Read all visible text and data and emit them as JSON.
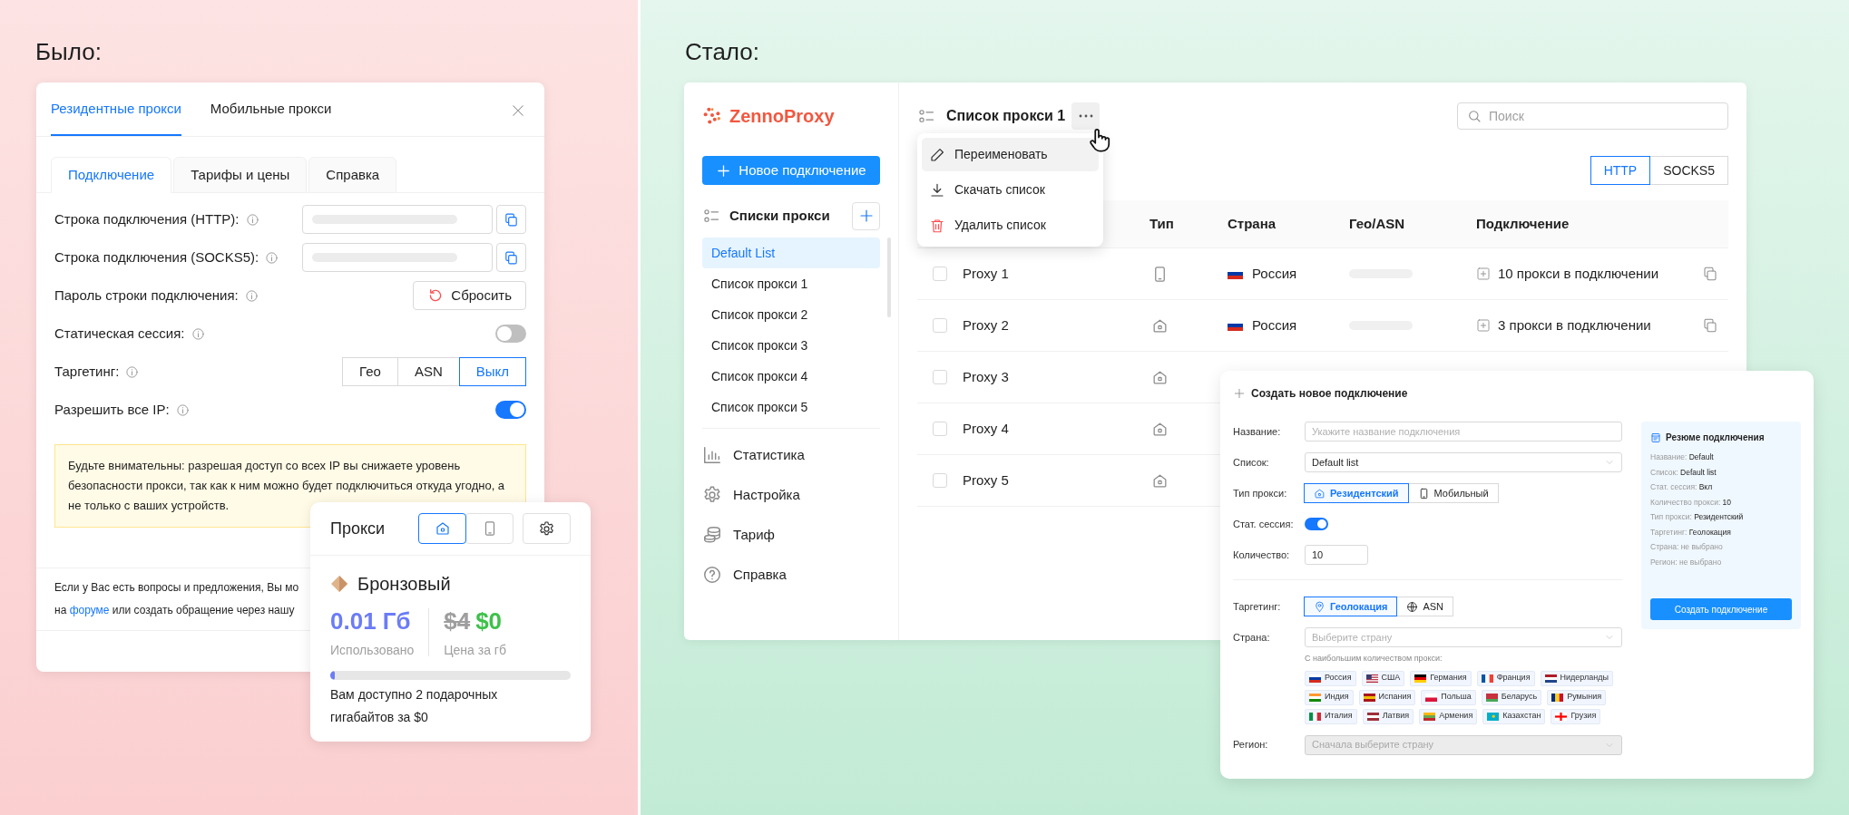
{
  "before": {
    "heading": "Было:",
    "dialog": {
      "tabs": [
        {
          "label": "Резидентные прокси",
          "selected": true
        },
        {
          "label": "Мобильные прокси",
          "selected": false
        }
      ],
      "subtabs": [
        {
          "label": "Подключение",
          "selected": true
        },
        {
          "label": "Тарифы и цены",
          "selected": false
        },
        {
          "label": "Справка",
          "selected": false
        }
      ],
      "rows": [
        {
          "kind": "copy_field",
          "label": "Строка подключения (HTTP):"
        },
        {
          "kind": "copy_field",
          "label": "Строка подключения (SOCKS5):"
        },
        {
          "kind": "button",
          "label": "Пароль строки подключения:",
          "button": "Сбросить"
        },
        {
          "kind": "toggle",
          "label": "Статическая сессия:",
          "on": false
        },
        {
          "kind": "segmented",
          "label": "Таргетинг:",
          "options": [
            {
              "label": "Гео",
              "selected": false
            },
            {
              "label": "ASN",
              "selected": false
            },
            {
              "label": "Выкл",
              "selected": true
            }
          ]
        },
        {
          "kind": "toggle",
          "label": "Разрешить все IP:",
          "on": true
        }
      ],
      "warning": "Будьте внимательны: разрешая доступ со всех IP вы снижаете уровень безопасности прокси, так как к ним можно будет подключиться откуда угодно, а не только с ваших устройств.",
      "footer": {
        "line1": "Если у Вас есть вопросы и предложения, Вы мо",
        "before_link": "на",
        "link": "форуме",
        "after_link": "или создать обращение через нашу"
      }
    },
    "widget": {
      "title": "Прокси",
      "modes": [
        {
          "kind": "home",
          "selected": true
        },
        {
          "kind": "mobile",
          "selected": false
        }
      ],
      "plan": "Бронзовый",
      "used": "0.01 Гб",
      "used_label": "Использовано",
      "old_price": "$4",
      "price": "$0",
      "price_label": "Цена за гб",
      "level": 0.02,
      "note": "Вам доступно 2 подарочных гигабайтов за $0"
    }
  },
  "after": {
    "heading": "Стало:",
    "brand": "ZennoProxy",
    "new_button": "Новое подключение",
    "lists_title": "Списки прокси",
    "lists": [
      {
        "label": "Default List",
        "selected": true
      },
      {
        "label": "Список прокси 1",
        "selected": false
      },
      {
        "label": "Список прокси 2",
        "selected": false
      },
      {
        "label": "Список прокси 3",
        "selected": false
      },
      {
        "label": "Список прокси 4",
        "selected": false
      },
      {
        "label": "Список прокси 5",
        "selected": false
      }
    ],
    "nav": [
      {
        "kind": "stats",
        "label": "Статистика"
      },
      {
        "kind": "settings",
        "label": "Настройка"
      },
      {
        "kind": "tariff",
        "label": "Тариф"
      },
      {
        "kind": "help",
        "label": "Справка"
      }
    ],
    "list_title": "Список прокси 1",
    "search": {
      "placeholder": "Поиск"
    },
    "menu": [
      {
        "kind": "rename",
        "label": "Переименовать",
        "hovered": true
      },
      {
        "kind": "download",
        "label": "Скачать список",
        "hovered": false
      },
      {
        "kind": "delete",
        "label": "Удалить список",
        "hovered": false
      }
    ],
    "protocols": [
      {
        "label": "HTTP",
        "selected": true
      },
      {
        "label": "SOCKS5",
        "selected": false
      }
    ],
    "table": {
      "columns": [
        "Тип",
        "Страна",
        "Гео/ASN",
        "Подключение"
      ],
      "rows": [
        {
          "checked": false,
          "name": "Proxy 1",
          "kind": "mobile",
          "country": {
            "label": "Россия",
            "kind": "ru"
          },
          "connection": "10 прокси в подключении"
        },
        {
          "checked": false,
          "name": "Proxy 2",
          "kind": "home",
          "country": {
            "label": "Россия",
            "kind": "ru"
          },
          "connection": "3 прокси в подключении"
        },
        {
          "checked": false,
          "name": "Proxy 3",
          "kind": "home"
        },
        {
          "checked": false,
          "name": "Proxy 4",
          "kind": "home"
        },
        {
          "checked": false,
          "name": "Proxy 5",
          "kind": "home"
        }
      ]
    },
    "form": {
      "title": "Создать новое подключение",
      "name": {
        "label": "Название:",
        "placeholder": "Укажите название подключения"
      },
      "list": {
        "label": "Список:",
        "value": "Default list"
      },
      "type": {
        "label": "Тип прокси:",
        "options": [
          {
            "kind": "home",
            "label": "Резидентский",
            "selected": true
          },
          {
            "kind": "mobile",
            "label": "Мобильный",
            "selected": false
          }
        ]
      },
      "session": {
        "label": "Стат. сессия:",
        "on": true
      },
      "count": {
        "label": "Количество:",
        "value": "10"
      },
      "targeting": {
        "label": "Таргетинг:",
        "options": [
          {
            "kind": "pin",
            "label": "Геолокация",
            "selected": true
          },
          {
            "kind": "globe",
            "label": "ASN",
            "selected": false
          }
        ]
      },
      "country": {
        "label": "Страна:",
        "placeholder": "Выберите страну"
      },
      "popular_hint": "С наибольшим количеством прокси:",
      "countries": [
        {
          "label": "Россия",
          "kind": "ru"
        },
        {
          "label": "США",
          "kind": "us"
        },
        {
          "label": "Германия",
          "kind": "de"
        },
        {
          "label": "Франция",
          "kind": "fr"
        },
        {
          "label": "Нидерланды",
          "kind": "nl"
        },
        {
          "label": "Индия",
          "kind": "in"
        },
        {
          "label": "Испания",
          "kind": "es"
        },
        {
          "label": "Польша",
          "kind": "pl"
        },
        {
          "label": "Беларусь",
          "kind": "by"
        },
        {
          "label": "Румыния",
          "kind": "ro"
        },
        {
          "label": "Италия",
          "kind": "it"
        },
        {
          "label": "Латвия",
          "kind": "lv"
        },
        {
          "label": "Армения",
          "kind": "am"
        },
        {
          "label": "Казахстан",
          "kind": "kz"
        },
        {
          "label": "Грузия",
          "kind": "ge"
        }
      ],
      "region": {
        "label": "Регион:",
        "placeholder": "Сначала выберите страну",
        "disabled": true
      },
      "summary": {
        "title": "Резюме подключения",
        "lines": [
          {
            "label": "Название:",
            "value": "Default",
            "empty": false
          },
          {
            "label": "Список:",
            "value": "Default list",
            "empty": false
          },
          {
            "label": "Стат. сессия:",
            "value": "Вкл",
            "empty": false
          },
          {
            "label": "Количество прокси:",
            "value": "10",
            "empty": false
          },
          {
            "label": "Тип прокси:",
            "value": "Резидентский",
            "empty": false
          },
          {
            "label": "Таргетинг:",
            "value": "Геолокация",
            "empty": false
          },
          {
            "label": "Страна:",
            "value": "не выбрано",
            "empty": true
          },
          {
            "label": "Регион:",
            "value": "не выбрано",
            "empty": true
          }
        ],
        "button": "Создать подключение"
      }
    }
  }
}
